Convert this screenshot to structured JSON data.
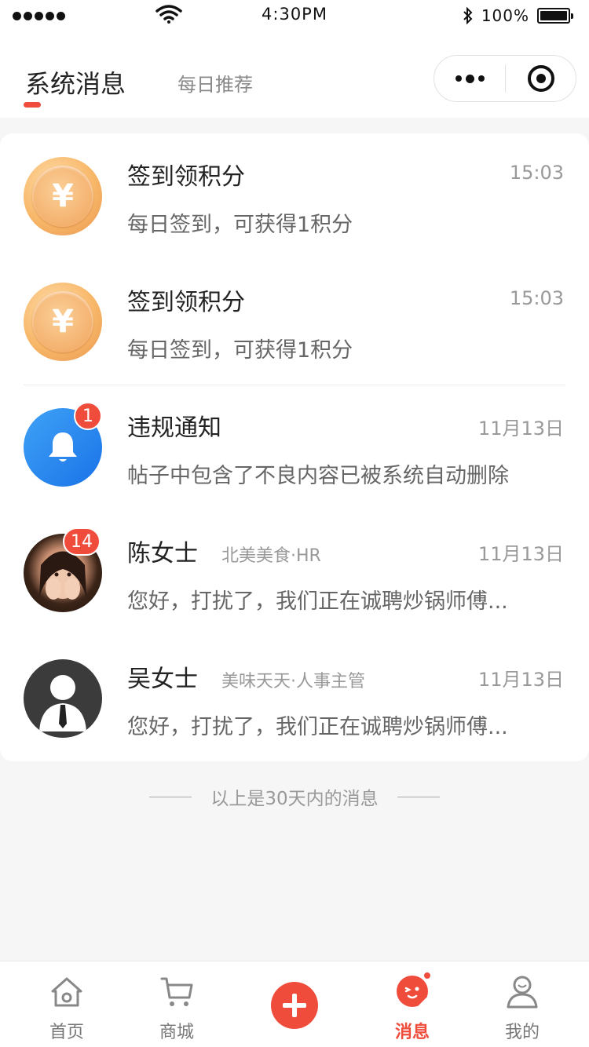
{
  "status_bar": {
    "time": "4:30PM",
    "battery": "100%"
  },
  "header": {
    "tabs": [
      {
        "label": "系统消息",
        "active": true
      },
      {
        "label": "每日推荐",
        "active": false
      }
    ]
  },
  "messages": [
    {
      "title": "签到领积分",
      "subtitle": "",
      "time": "15:03",
      "desc": "每日签到，可获得1积分",
      "avatar": "coin-icon",
      "badge": ""
    },
    {
      "title": "签到领积分",
      "subtitle": "",
      "time": "15:03",
      "desc": "每日签到，可获得1积分",
      "avatar": "coin-icon",
      "badge": ""
    },
    {
      "title": "违规通知",
      "subtitle": "",
      "time": "11月13日",
      "desc": "帖子中包含了不良内容已被系统自动删除",
      "avatar": "bell-icon",
      "badge": "1"
    },
    {
      "title": "陈女士",
      "subtitle": "北美美食·HR",
      "time": "11月13日",
      "desc": "您好，打扰了，我们正在诚聘炒锅师傅...",
      "avatar": "photo",
      "badge": "14"
    },
    {
      "title": "吴女士",
      "subtitle": "美味天天·人事主管",
      "time": "11月13日",
      "desc": "您好，打扰了，我们正在诚聘炒锅师傅...",
      "avatar": "user-icon",
      "badge": ""
    }
  ],
  "footer_note": "以上是30天内的消息",
  "tabbar": [
    {
      "label": "首页",
      "icon": "home-icon",
      "active": false
    },
    {
      "label": "商城",
      "icon": "cart-icon",
      "active": false
    },
    {
      "label": "",
      "icon": "plus-icon",
      "active": false
    },
    {
      "label": "消息",
      "icon": "message-icon",
      "active": true
    },
    {
      "label": "我的",
      "icon": "profile-icon",
      "active": false
    }
  ],
  "colors": {
    "accent": "#f04c3c",
    "blue": "#1a73e8",
    "coin": "#f1a45c"
  },
  "yen_symbol": "¥"
}
